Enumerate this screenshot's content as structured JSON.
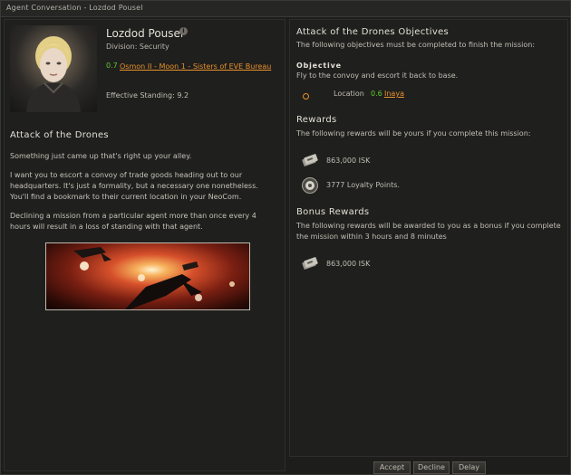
{
  "window": {
    "title": "Agent Conversation - Lozdod Pousel"
  },
  "agent": {
    "name": "Lozdod Pousel",
    "division": "Division: Security",
    "security_status": "0.7",
    "location": "Osmon II - Moon 1 - Sisters of EVE Bureau",
    "standing": "Effective Standing: 9.2"
  },
  "mission": {
    "title": "Attack of the Drones",
    "paragraphs": [
      "Something just came up that's right up your alley.",
      "I want you to escort a convoy of trade goods heading out to our headquarters. It's just a formality, but a necessary one nonetheless. You'll find a bookmark to their current location in your NeoCom.",
      "Declining a mission from a particular agent more than once every 4 hours will result in a loss of standing with that agent."
    ]
  },
  "objectives": {
    "title": "Attack of the Drones Objectives",
    "subtitle": "The following objectives must be completed to finish the mission:",
    "heading": "Objective",
    "text": "Fly to the convoy and escort it back to base.",
    "location_label": "Location",
    "location_security": "0.6",
    "location_name": "Inaya"
  },
  "rewards": {
    "heading": "Rewards",
    "subtitle": "The following rewards will be yours if you complete this mission:",
    "items": [
      {
        "icon": "isk-icon",
        "text": "863,000 ISK"
      },
      {
        "icon": "loyalty-points-icon",
        "text": "3777 Loyalty Points."
      }
    ]
  },
  "bonus": {
    "heading": "Bonus Rewards",
    "subtitle": "The following rewards will be awarded to you as a bonus if you complete the mission within 3 hours and 8 minutes",
    "items": [
      {
        "icon": "isk-icon",
        "text": "863,000 ISK"
      }
    ]
  },
  "buttons": {
    "accept": "Accept",
    "decline": "Decline",
    "delay": "Delay"
  },
  "colors": {
    "accent": "#e8902c",
    "security_high": "#5ecb2f",
    "background": "#1d1d1c"
  }
}
